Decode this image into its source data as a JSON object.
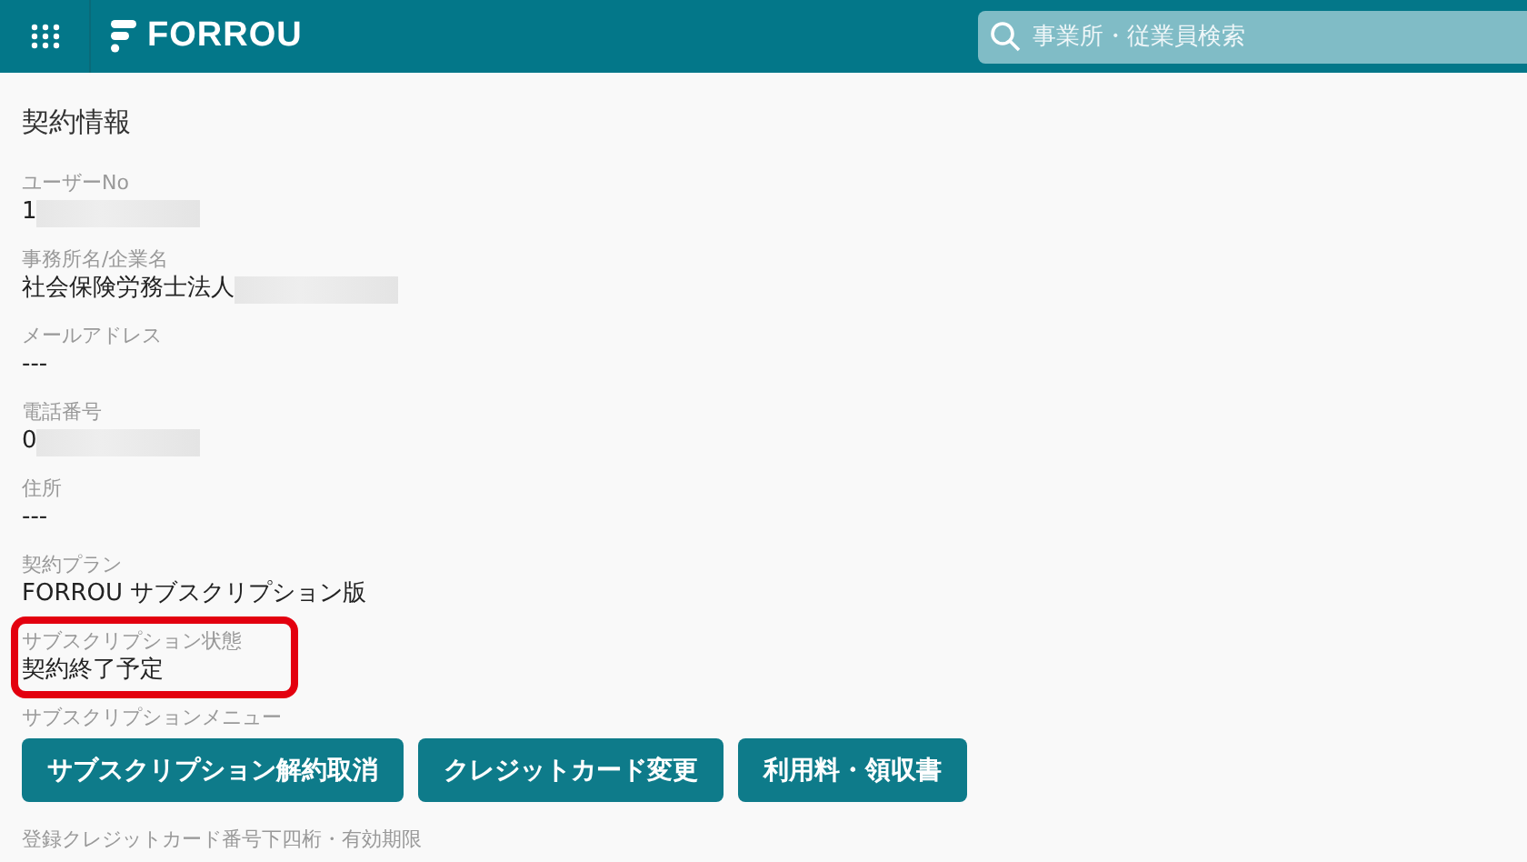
{
  "header": {
    "logo": "FORROU",
    "search": {
      "placeholder": "事業所・従業員検索"
    }
  },
  "title": "契約情報",
  "fields": [
    {
      "kind": "text",
      "label": "ユーザーNo",
      "value": "1",
      "redacted": true
    },
    {
      "kind": "text",
      "label": "事務所名/企業名",
      "value": "社会保険労務士法人",
      "redacted": true
    },
    {
      "kind": "text",
      "label": "メールアドレス",
      "value": "---"
    },
    {
      "kind": "text",
      "label": "電話番号",
      "value": "0",
      "redacted": true
    },
    {
      "kind": "text",
      "label": "住所",
      "value": "---"
    },
    {
      "kind": "text",
      "label": "契約プラン",
      "value": "FORROU サブスクリプション版"
    },
    {
      "kind": "text",
      "label": "サブスクリプション状態",
      "value": "契約終了予定",
      "highlighted": true
    },
    {
      "kind": "buttons",
      "label": "サブスクリプションメニュー",
      "buttons": [
        "サブスクリプション解約取消",
        "クレジットカード変更",
        "利用料・領収書"
      ]
    },
    {
      "kind": "text",
      "label": "登録クレジットカード番号下四桁・有効期限"
    }
  ]
}
